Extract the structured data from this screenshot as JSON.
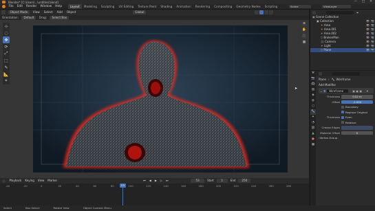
{
  "titlebar": {
    "title": "Blender* [C:\\Users\\...\\untitled.blend]",
    "min": "—",
    "max": "□",
    "close": "✕"
  },
  "menu": {
    "items": [
      "File",
      "Edit",
      "Render",
      "Window",
      "Help"
    ]
  },
  "workspaces": {
    "tabs": [
      "Layout",
      "Modeling",
      "Sculpting",
      "UV Editing",
      "Texture Paint",
      "Shading",
      "Animation",
      "Rendering",
      "Compositing",
      "Geometry Nodes",
      "Scripting"
    ],
    "active": 0
  },
  "scene": {
    "label": "Scene",
    "view_layer": "ViewLayer"
  },
  "viewport_header": {
    "mode": "Object Mode",
    "menus": [
      "View",
      "Select",
      "Add",
      "Object"
    ],
    "transform": "Global"
  },
  "viewport_header2": {
    "orientation_label": "Orientation:",
    "orientation": "Default",
    "drag_label": "Drag:",
    "drag": "Select Box"
  },
  "tools": [
    "⊹",
    "◌",
    "✥",
    "⟳",
    "⤢",
    "⬚",
    "✎",
    "📐",
    "⌖"
  ],
  "gizmo": [
    "⊕",
    "✋",
    "🎥",
    "▦"
  ],
  "timeline": {
    "menus": [
      "Playback",
      "Keying",
      "View",
      "Marker"
    ],
    "start_label": "Start",
    "start": "1",
    "end_label": "End",
    "end": "250",
    "current": "53",
    "ticks": [
      "-40",
      "-20",
      "0",
      "20",
      "40",
      "60",
      "80",
      "100",
      "120",
      "140",
      "160",
      "180",
      "200",
      "220",
      "240",
      "260",
      "280"
    ]
  },
  "status": {
    "items": [
      "Select",
      "Box Select",
      "Rotate View",
      "Object Context Menu"
    ]
  },
  "outliner": {
    "root": "Scene Collection",
    "rows": [
      {
        "label": "Collection",
        "indent": 1
      },
      {
        "label": "Area",
        "indent": 2
      },
      {
        "label": "Area.001",
        "indent": 2
      },
      {
        "label": "Area.002",
        "indent": 2
      },
      {
        "label": "BrokenMan",
        "indent": 2
      },
      {
        "label": "Camera",
        "indent": 2
      },
      {
        "label": "Light",
        "indent": 2
      },
      {
        "label": "Plane",
        "indent": 2
      }
    ],
    "selected": 7
  },
  "properties": {
    "breadcrumb_object": "Plane",
    "breadcrumb_mod": "Wireframe",
    "add_modifier": "Add Modifier",
    "modifier_name": "Wireframe",
    "thickness_label": "Thickness",
    "thickness": "0.02 m",
    "offset_label": "Offset",
    "offset": "-1.000",
    "boundary": "Boundary",
    "replace_original": "Replace Original",
    "thickness2_label": "Thickness",
    "even": "Even",
    "relative": "Relative",
    "crease_edges": "Crease Edges",
    "material_offset_label": "Material Offset",
    "material_offset": "0",
    "vertex_group": "Vertex Group"
  }
}
